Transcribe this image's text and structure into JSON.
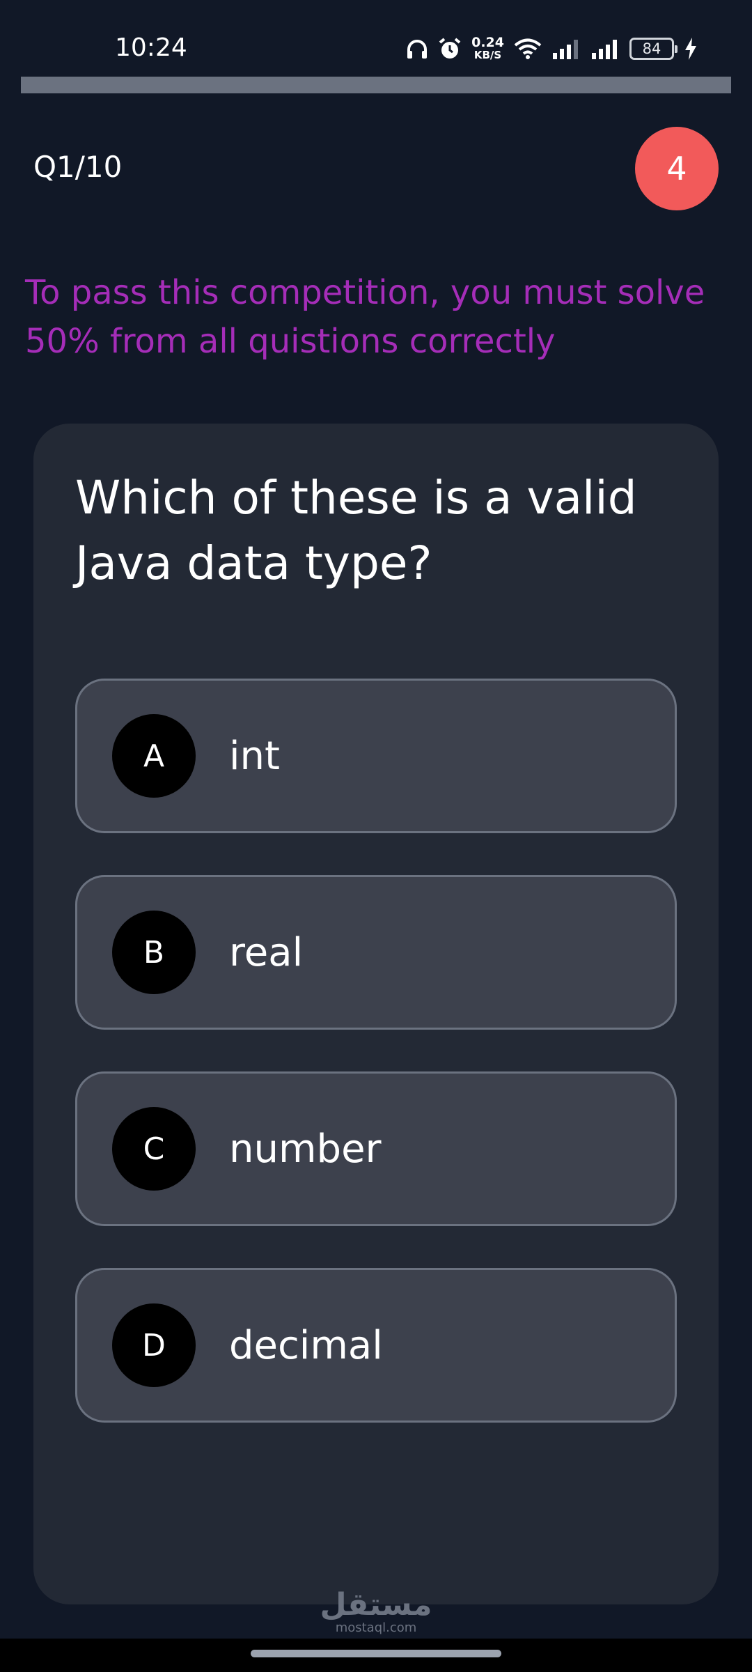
{
  "status_bar": {
    "time": "10:24",
    "net_speed_value": "0.24",
    "net_speed_unit": "KB/S",
    "battery": "84"
  },
  "progress": {
    "fraction": 1.0
  },
  "header": {
    "question_counter": "Q1/10",
    "timer": "4"
  },
  "notice": "To pass this competition, you must solve 50% from all quistions correctly",
  "question": {
    "text": "Which of these is a valid Java data type?",
    "options": [
      {
        "letter": "A",
        "text": "int"
      },
      {
        "letter": "B",
        "text": "real"
      },
      {
        "letter": "C",
        "text": "number"
      },
      {
        "letter": "D",
        "text": "decimal"
      }
    ]
  },
  "watermark": {
    "arabic": "مستقل",
    "latin": "mostaql.com"
  },
  "colors": {
    "background": "#111827",
    "card": "#232935",
    "option": "#3d414d",
    "timer_badge": "#f25a5a",
    "notice_text": "#a52db8"
  }
}
